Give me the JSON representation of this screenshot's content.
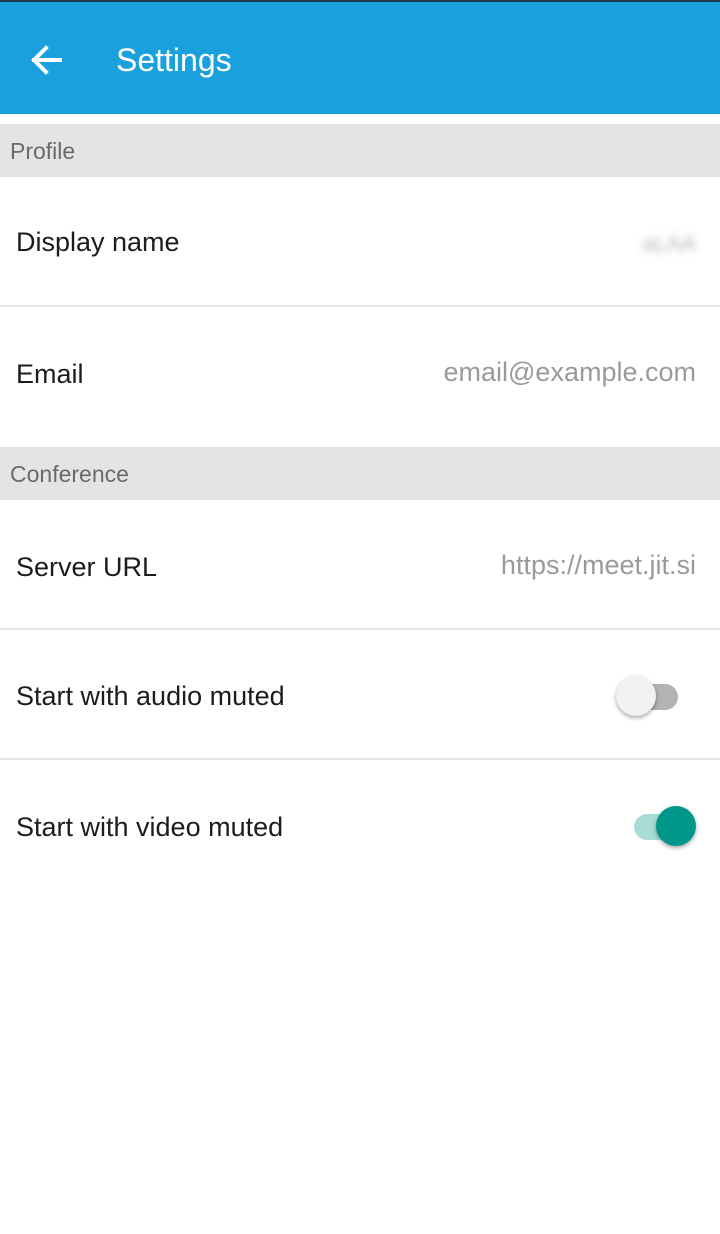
{
  "app_bar": {
    "title": "Settings",
    "back_icon": "arrow-left-icon",
    "color": "#1aa0dc"
  },
  "sections": {
    "profile": {
      "header": "Profile",
      "display_name": {
        "label": "Display name",
        "value": "aLAA"
      },
      "email": {
        "label": "Email",
        "placeholder": "email@example.com"
      }
    },
    "conference": {
      "header": "Conference",
      "server_url": {
        "label": "Server URL",
        "placeholder": "https://meet.jit.si"
      },
      "audio_muted": {
        "label": "Start with audio muted",
        "checked": false
      },
      "video_muted": {
        "label": "Start with video muted",
        "checked": true
      }
    }
  },
  "colors": {
    "switch_on_thumb": "#00968a",
    "switch_on_track": "#a9dcd6",
    "switch_off_thumb": "#f1f1f1",
    "switch_off_track": "#b3b3b3",
    "section_header_bg": "#e4e4e4"
  }
}
